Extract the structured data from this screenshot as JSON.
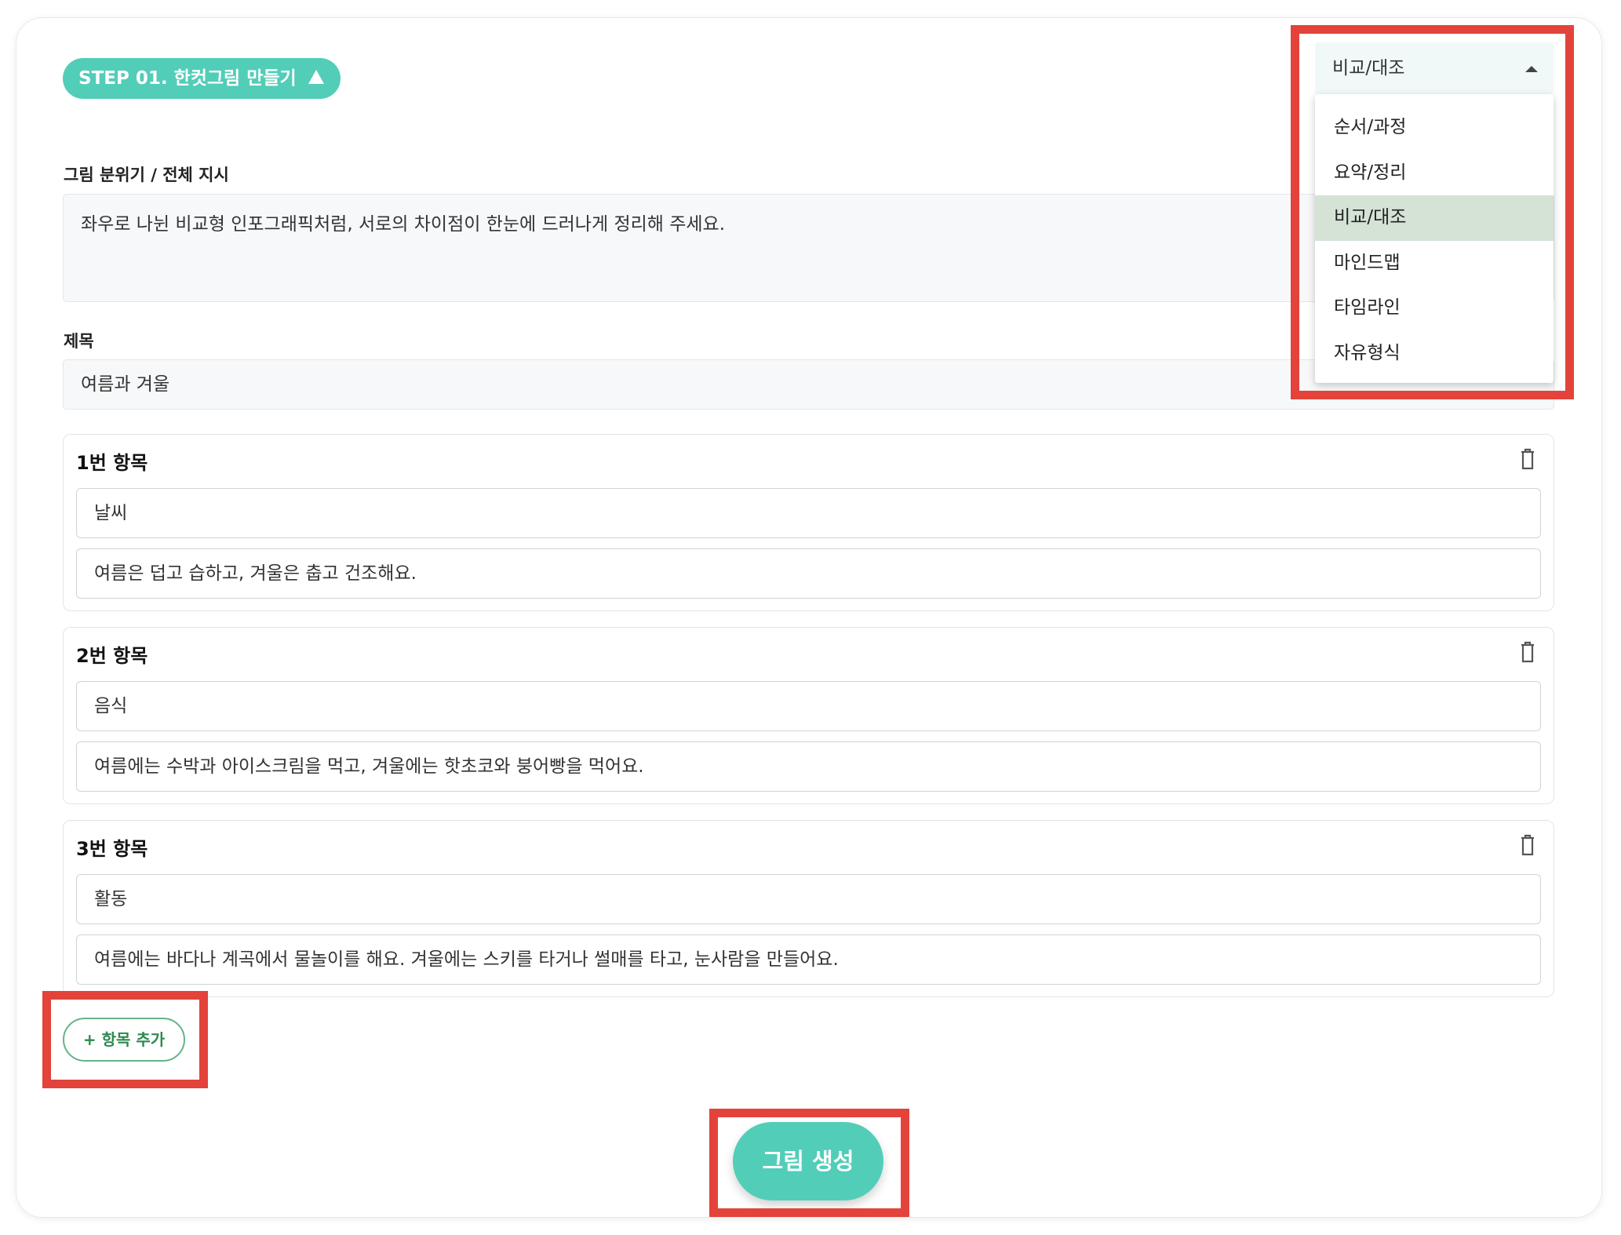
{
  "step": {
    "label": "STEP 01. 한컷그림 만들기"
  },
  "mood": {
    "label": "그림 분위기 / 전체 지시",
    "value": "좌우로 나뉜 비교형 인포그래픽처럼, 서로의 차이점이 한눈에 드러나게 정리해 주세요."
  },
  "title_field": {
    "label": "제목",
    "value": "여름과 겨울"
  },
  "items": [
    {
      "heading": "1번 항목",
      "name": "날씨",
      "desc": "여름은 덥고 습하고, 겨울은 춥고 건조해요."
    },
    {
      "heading": "2번 항목",
      "name": "음식",
      "desc": "여름에는 수박과 아이스크림을 먹고, 겨울에는 핫초코와 붕어빵을 먹어요."
    },
    {
      "heading": "3번 항목",
      "name": "활동",
      "desc": "여름에는 바다나 계곡에서 물놀이를 해요. 겨울에는 스키를 타거나 썰매를 타고, 눈사람을 만들어요."
    }
  ],
  "add_button": {
    "label": "+ 항목 추가"
  },
  "generate_button": {
    "label": "그림 생성"
  },
  "type_select": {
    "value": "비교/대조",
    "options": [
      "순서/과정",
      "요약/정리",
      "비교/대조",
      "마인드맵",
      "타임라인",
      "자유형식"
    ],
    "selected_index": 2
  },
  "icons": {
    "step_toggle": "triangle-up-icon",
    "delete": "trash-icon",
    "select_caret": "caret-up-icon"
  },
  "colors": {
    "accent": "#52cdb8",
    "highlight": "#e3433a",
    "add_button_border": "#64b389",
    "selected_option_bg": "#d4e3d6"
  }
}
